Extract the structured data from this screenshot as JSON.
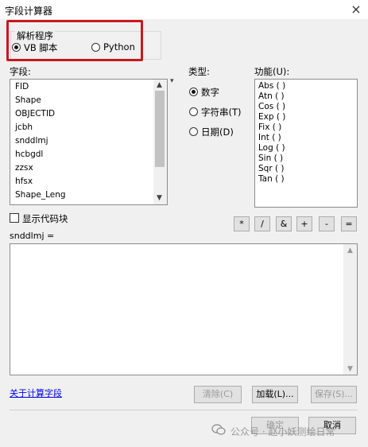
{
  "window": {
    "title": "字段计算器",
    "close_glyph": "×"
  },
  "parser": {
    "label": "解析程序",
    "options": [
      {
        "label": "VB 脚本",
        "selected": true
      },
      {
        "label": "Python",
        "selected": false
      }
    ],
    "highlight_color": "#c8191e"
  },
  "fields": {
    "label": "字段:",
    "items": [
      "FID",
      "Shape",
      "OBJECTID",
      "jcbh",
      "snddlmj",
      "hcbgdl",
      "zzsx",
      "hfsx",
      "Shape_Leng"
    ],
    "dropdown_glyph": "▾"
  },
  "type": {
    "label": "类型:",
    "options": [
      {
        "label": "数字",
        "selected": true
      },
      {
        "label": "字符串(T)",
        "selected": false
      },
      {
        "label": "日期(D)",
        "selected": false
      }
    ]
  },
  "functions": {
    "label": "功能(U):",
    "items": [
      "Abs ( )",
      "Atn ( )",
      "Cos ( )",
      "Exp ( )",
      "Fix ( )",
      "Int ( )",
      "Log ( )",
      "Sin ( )",
      "Sqr ( )",
      "Tan ( )"
    ]
  },
  "show_codeblock": {
    "label": "显示代码块",
    "checked": false
  },
  "operators": [
    "*",
    "/",
    "&",
    "+",
    "-",
    "="
  ],
  "expression": {
    "label": "snddlmj =",
    "value": ""
  },
  "about_link": "关于计算字段",
  "buttons": {
    "clear": "清除(C)",
    "load": "加载(L)...",
    "save": "保存(S)...",
    "ok": "确定",
    "cancel": "取消"
  },
  "watermark": "公众号 · 赵小妖测绘日常"
}
